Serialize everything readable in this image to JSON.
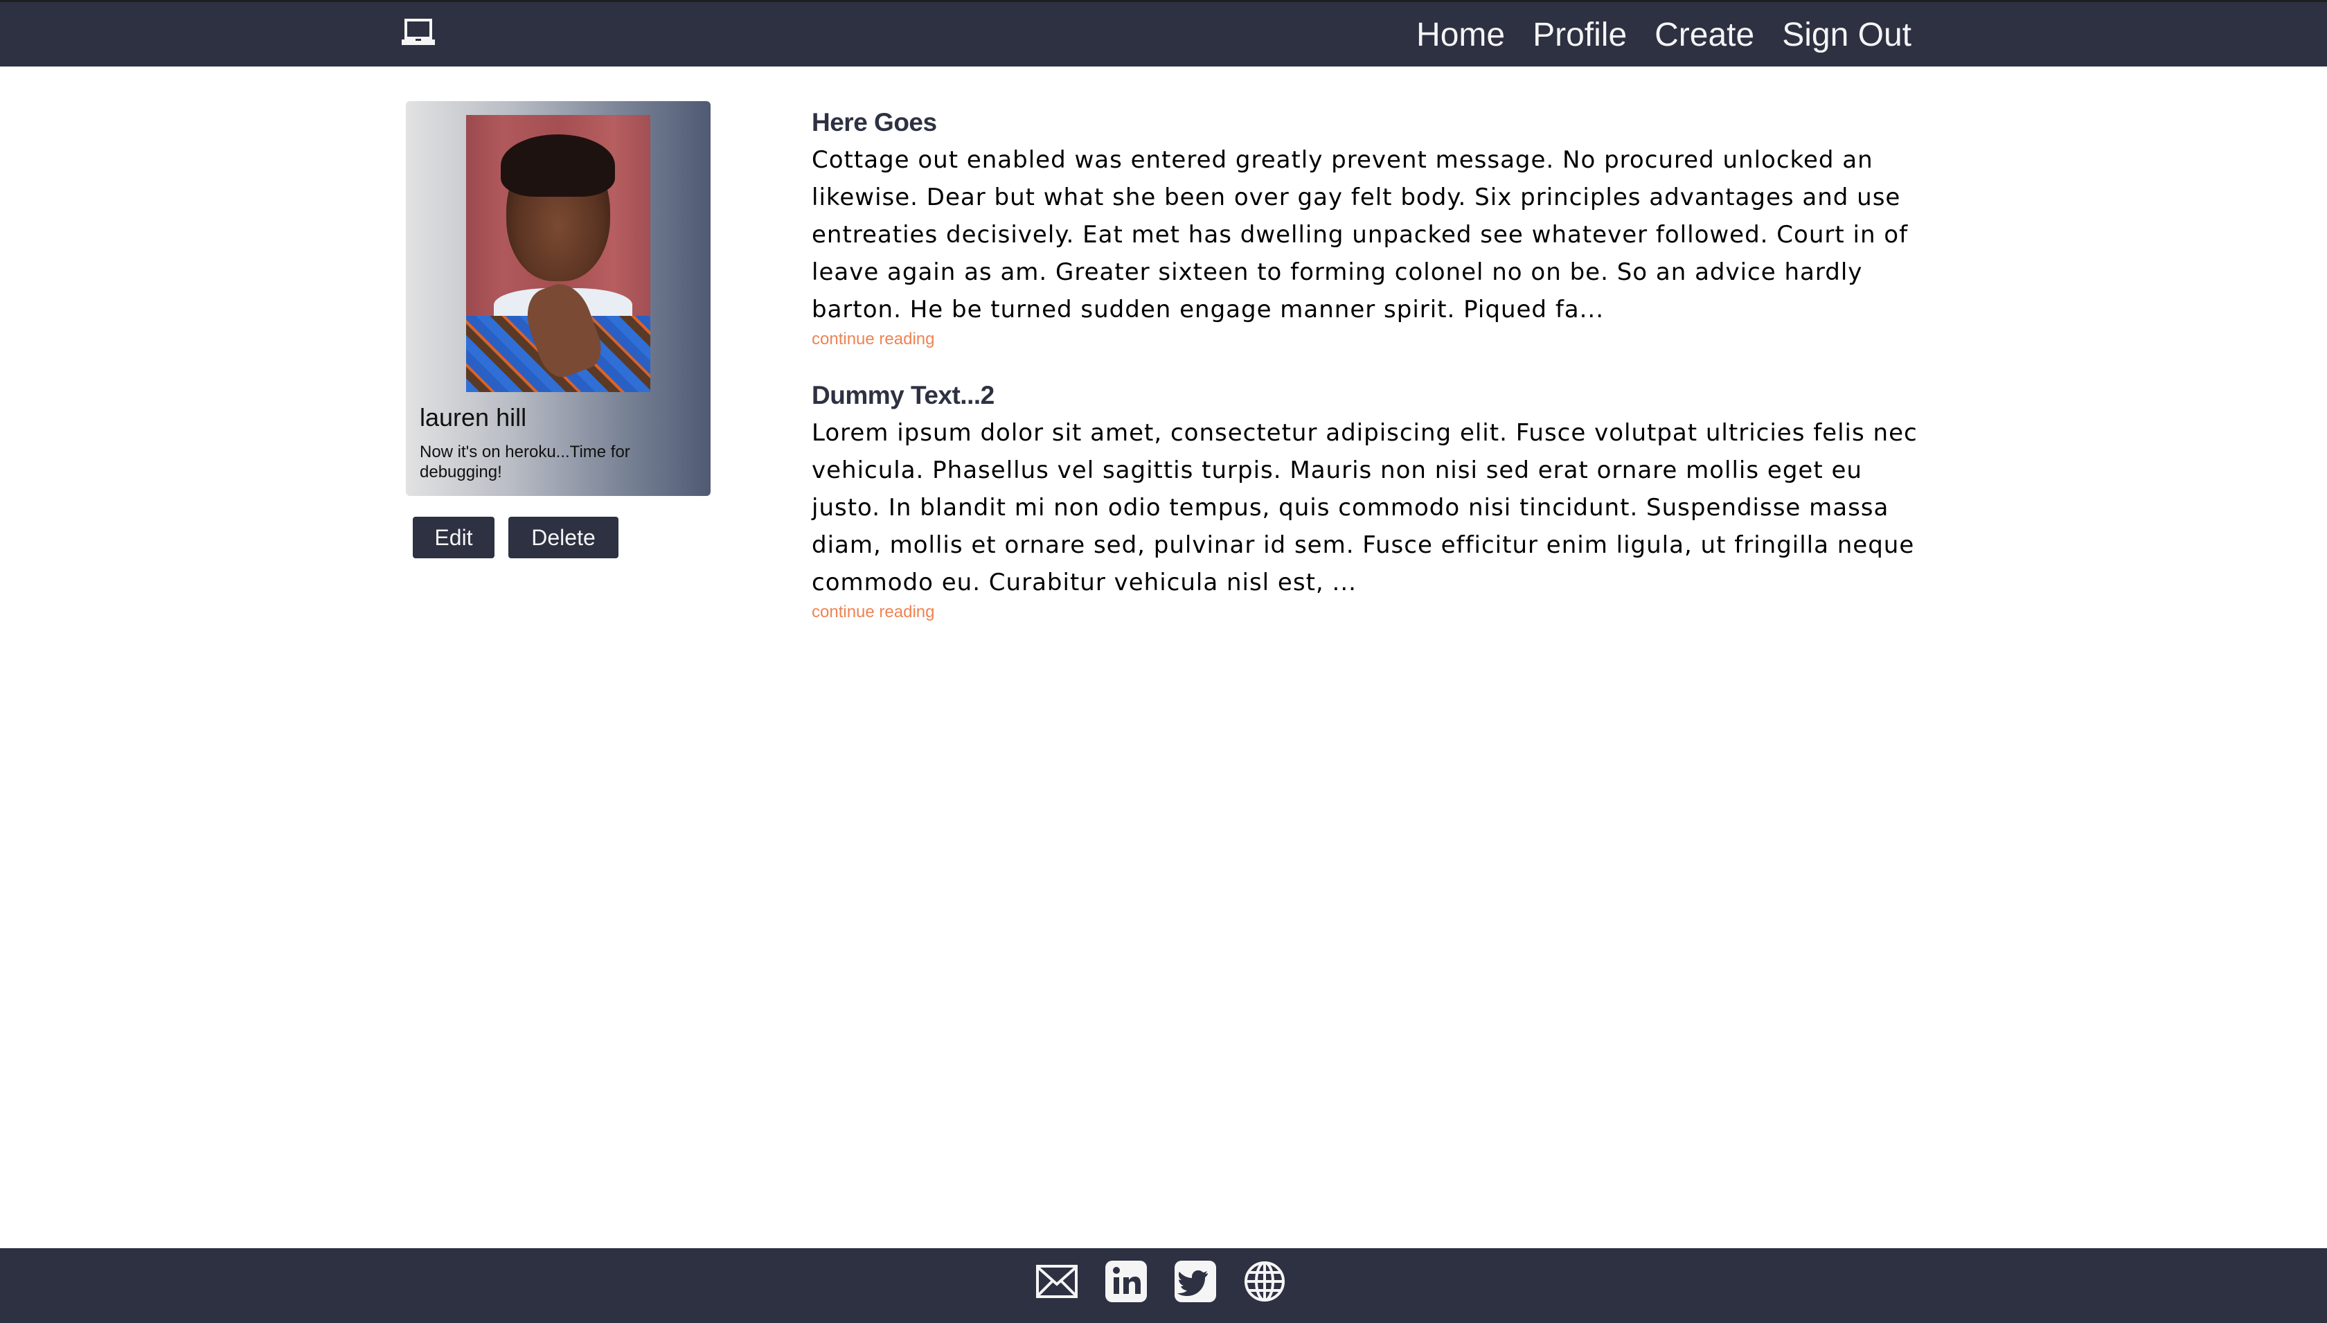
{
  "navbar": {
    "brand_icon": "laptop-icon",
    "links": [
      {
        "label": "Home"
      },
      {
        "label": "Profile"
      },
      {
        "label": "Create"
      },
      {
        "label": "Sign Out"
      }
    ]
  },
  "profile": {
    "name": "lauren hill",
    "bio": "Now it's on heroku...Time for debugging!",
    "photo_alt": "profile photo",
    "edit_label": "Edit",
    "delete_label": "Delete"
  },
  "posts": [
    {
      "title": "Here Goes",
      "excerpt": "Cottage out enabled was entered greatly prevent message. No procured unlocked an likewise. Dear but what she been over gay felt body. Six principles advantages and use entreaties decisively. Eat met has dwelling unpacked see whatever followed. Court in of leave again as am. Greater sixteen to forming colonel no on be. So an advice hardly barton. He be turned sudden engage manner spirit. Piqued fa...",
      "link_label": "continue reading"
    },
    {
      "title": "Dummy Text...2",
      "excerpt": "Lorem ipsum dolor sit amet, consectetur adipiscing elit. Fusce volutpat ultricies felis nec vehicula. Phasellus vel sagittis turpis. Mauris non nisi sed erat ornare mollis eget eu justo. In blandit mi non odio tempus, quis commodo nisi tincidunt. Suspendisse massa diam, mollis et ornare sed, pulvinar id sem. Fusce efficitur enim ligula, ut fringilla neque commodo eu. Curabitur vehicula nisl est, ...",
      "link_label": "continue reading"
    }
  ],
  "footer": {
    "icons": [
      "email-icon",
      "linkedin-icon",
      "twitter-icon",
      "globe-icon"
    ]
  },
  "colors": {
    "primary": "#2d3142",
    "secondary": "#4f5d75",
    "accent": "#ef8354",
    "background": "#ffffff"
  }
}
